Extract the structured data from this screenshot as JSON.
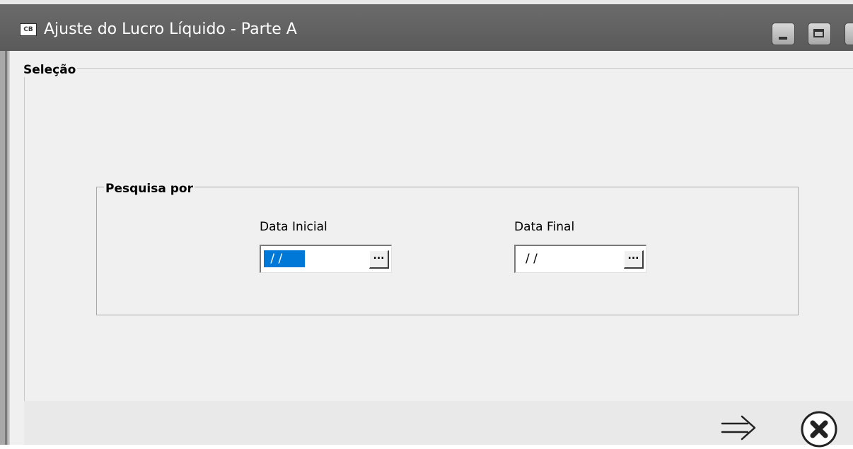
{
  "window": {
    "app_icon_label": "CB",
    "title": "Ajuste do Lucro Líquido - Parte A"
  },
  "selection_group": {
    "legend": "Seleção"
  },
  "search_group": {
    "legend": "Pesquisa por",
    "start_date": {
      "label": "Data Inicial",
      "value": " / / ",
      "button_label": "..."
    },
    "end_date": {
      "label": "Data Final",
      "value": "/ /",
      "button_label": "..."
    }
  },
  "footer": {
    "icons": [
      "arrow-right-icon",
      "cancel-circle-icon"
    ]
  },
  "colors": {
    "titlebar": "#5f5f5f",
    "background": "#f0f0f0",
    "selection_highlight": "#0078d7"
  }
}
